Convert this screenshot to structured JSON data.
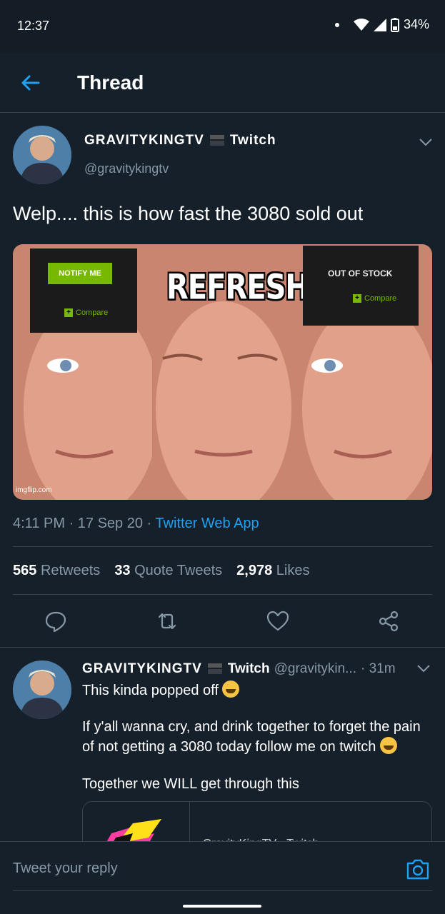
{
  "status_bar": {
    "time": "12:37",
    "battery": "34%"
  },
  "app_bar": {
    "title": "Thread"
  },
  "tweet": {
    "author_name": "GRAVITYKINGTV",
    "author_badge": "Twitch",
    "handle": "@gravitykingtv",
    "text": "Welp.... this is how fast the 3080 sold out",
    "media": {
      "notify_button": "NOTIFY ME",
      "compare": "Compare",
      "refresh": "REFRESH",
      "out_of_stock": "OUT OF STOCK",
      "watermark": "imgflip.com"
    },
    "time": "4:11 PM",
    "date": "17 Sep 20",
    "source": "Twitter Web App",
    "stats": {
      "retweets_count": "565",
      "retweets_label": "Retweets",
      "quotes_count": "33",
      "quotes_label": "Quote Tweets",
      "likes_count": "2,978",
      "likes_label": "Likes"
    }
  },
  "reply": {
    "author_name": "GRAVITYKINGTV",
    "author_badge": "Twitch",
    "handle": "@gravitykin...",
    "time": "· 31m",
    "line1": "This kinda popped off",
    "line2": "If y'all wanna cry, and drink together to forget the pain of not getting a 3080 today follow me on twitch",
    "line3": "Together we WILL get through this",
    "card_text": "GravityKingTV - Twitch"
  },
  "reply_bar": {
    "placeholder": "Tweet your reply"
  },
  "colors": {
    "background": "#15202b",
    "accent": "#1da1f2",
    "divider": "#38444d",
    "muted": "#8899a6"
  }
}
